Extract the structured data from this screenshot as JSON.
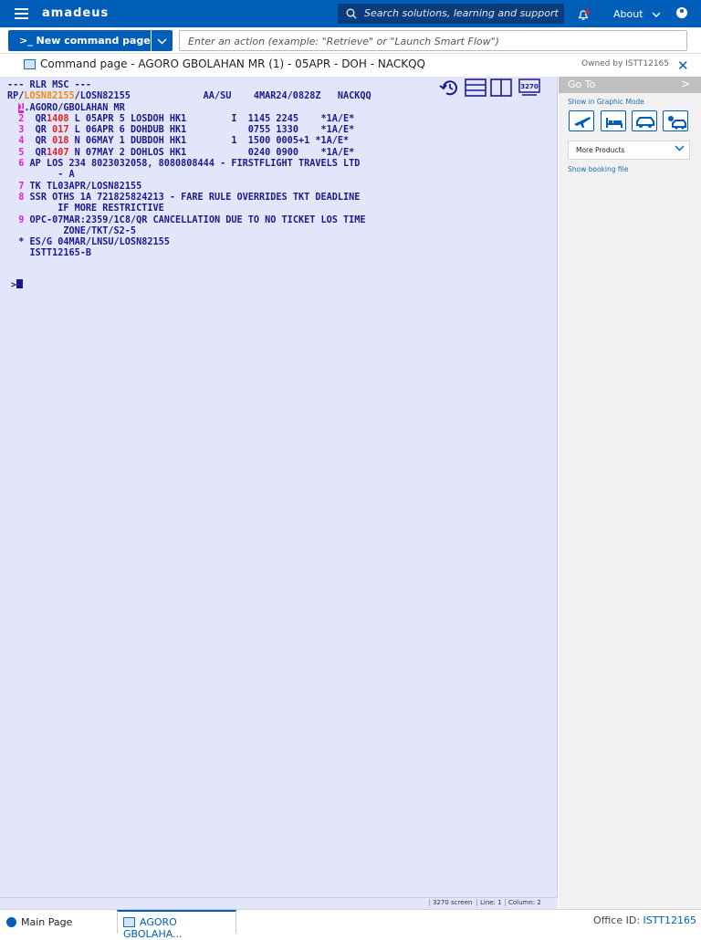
{
  "topbar": {
    "brand": "amadeus",
    "search_placeholder": "Search solutions, learning and support",
    "about_label": "About"
  },
  "commandbar": {
    "new_command_label": ">_ New command page",
    "action_placeholder": "Enter an action (example: \"Retrieve\" or \"Launch Smart Flow\")"
  },
  "page": {
    "title": "Command page - AGORO GBOLAHAN MR (1) - 05APR - DOH - NACKQQ",
    "owned_by": "Owned by ISTT12165"
  },
  "terminal": {
    "tool_3270_label": "3270",
    "lines": [
      [
        {
          "t": "--- RLR MSC ---",
          "c": ""
        }
      ],
      [
        {
          "t": "RP/",
          "c": ""
        },
        {
          "t": "LOSN82155",
          "c": "orange"
        },
        {
          "t": "/LOSN82155             AA/SU    4MAR24/0828Z   NACKQQ",
          "c": ""
        }
      ],
      [
        {
          "t": "  ",
          "c": ""
        },
        {
          "t": "1",
          "c": "cursor-hl"
        },
        {
          "t": ".AGORO/GBOLAHAN MR",
          "c": ""
        }
      ],
      [
        {
          "t": "  2  ",
          "c": "num"
        },
        {
          "t": "QR",
          "c": ""
        },
        {
          "t": "1408",
          "c": "red"
        },
        {
          "t": " L 05APR 5 LOSDOH HK1        I  1145 2245    *1A/E*",
          "c": ""
        }
      ],
      [
        {
          "t": "  3  ",
          "c": "num"
        },
        {
          "t": "QR ",
          "c": ""
        },
        {
          "t": "017",
          "c": "red"
        },
        {
          "t": " L 06APR 6 DOHDUB HK1           0755 1330    *1A/E*",
          "c": ""
        }
      ],
      [
        {
          "t": "  4  ",
          "c": "num"
        },
        {
          "t": "QR ",
          "c": ""
        },
        {
          "t": "018",
          "c": "red"
        },
        {
          "t": " N 06MAY 1 DUBDOH HK1        1  1500 0005+1 *1A/E*",
          "c": ""
        }
      ],
      [
        {
          "t": "  5  ",
          "c": "num"
        },
        {
          "t": "QR",
          "c": ""
        },
        {
          "t": "1407",
          "c": "red"
        },
        {
          "t": " N 07MAY 2 DOHLOS HK1           0240 0900    *1A/E*",
          "c": ""
        }
      ],
      [
        {
          "t": "  6 ",
          "c": "num"
        },
        {
          "t": "AP LOS 234 8023032058, 8080808444 - FIRSTFLIGHT TRAVELS LTD",
          "c": ""
        }
      ],
      [
        {
          "t": "         - A",
          "c": ""
        }
      ],
      [
        {
          "t": "  7 ",
          "c": "num"
        },
        {
          "t": "TK TL03APR/LOSN82155",
          "c": ""
        }
      ],
      [
        {
          "t": "  8 ",
          "c": "num"
        },
        {
          "t": "SSR OTHS 1A 721825824213 - FARE RULE OVERRIDES TKT DEADLINE",
          "c": ""
        }
      ],
      [
        {
          "t": "         IF MORE RESTRICTIVE",
          "c": ""
        }
      ],
      [
        {
          "t": "  9 ",
          "c": "num"
        },
        {
          "t": "OPC-07MAR:2359/1C8/QR CANCELLATION DUE TO NO TICKET LOS TIME",
          "c": ""
        }
      ],
      [
        {
          "t": "          ZONE/TKT/S2-5",
          "c": ""
        }
      ],
      [
        {
          "t": "  * ES/G 04MAR/LNSU/LOSN82155",
          "c": ""
        }
      ],
      [
        {
          "t": "    ISTT12165-B",
          "c": ""
        }
      ]
    ],
    "prompt": ">"
  },
  "statusbar": {
    "mode": "3270 screen",
    "line": "Line: 1",
    "column": "Column: 2"
  },
  "goto": {
    "title": "Go To",
    "graphic_mode_link": "Show in Graphic Mode",
    "products": [
      "flight-icon",
      "hotel-icon",
      "car-icon",
      "transfer-icon"
    ],
    "more_products_label": "More Products",
    "booking_file_link": "Show booking file"
  },
  "bottombar": {
    "main_tab": "Main Page",
    "active_tab": "AGORO GBOLAHA...",
    "office_label": "Office ID:",
    "office_id": "ISTT12165"
  }
}
